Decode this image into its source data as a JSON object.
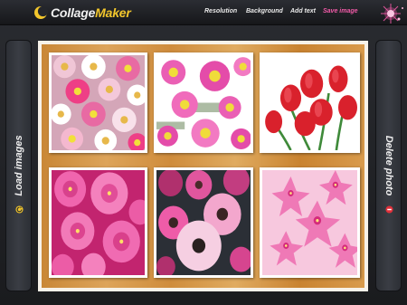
{
  "app": {
    "logo_prefix": "Collage",
    "logo_suffix": "Maker",
    "logo_icon": "crescent-logo-icon",
    "accent_color": "#f2c62c",
    "highlight_color": "#f25aa8"
  },
  "menu": {
    "resolution": "Resolution",
    "background": "Background",
    "add_text": "Add text",
    "save_image": "Save image"
  },
  "sidebar_left": {
    "label": "Load images",
    "icon": "refresh-icon"
  },
  "sidebar_right": {
    "label": "Delete photo",
    "icon": "delete-icon"
  },
  "collage": {
    "background_color": "#d39541",
    "frame_color": "#f7f2e9",
    "photos": [
      {
        "subject": "pink and white flowers",
        "icon": "photo-icon"
      },
      {
        "subject": "pink daisies",
        "icon": "photo-icon"
      },
      {
        "subject": "red tulips",
        "icon": "photo-icon"
      },
      {
        "subject": "pink roses",
        "icon": "photo-icon"
      },
      {
        "subject": "pink gerbera daisies",
        "icon": "photo-icon"
      },
      {
        "subject": "pink plumeria",
        "icon": "photo-icon"
      }
    ]
  }
}
